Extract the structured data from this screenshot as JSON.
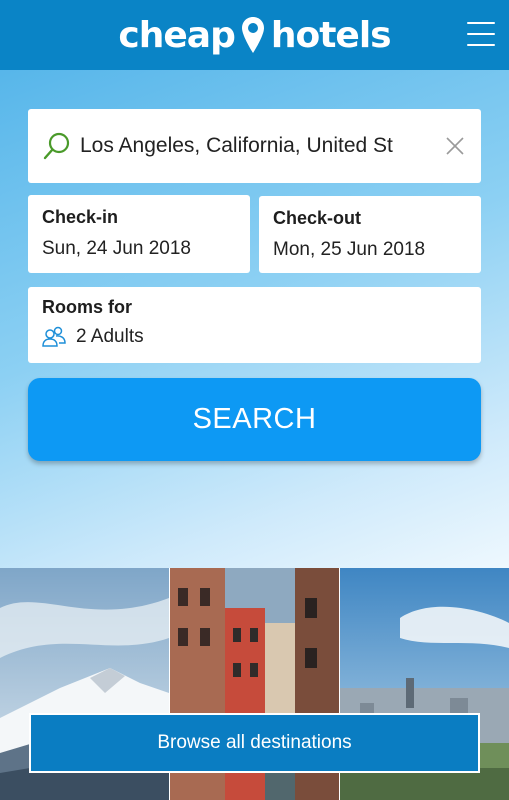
{
  "header": {
    "logo_left": "cheap",
    "logo_right": "hotels",
    "menu_icon": "hamburger-menu-icon"
  },
  "search_form": {
    "destination": {
      "value": "Los Angeles, California, United St",
      "icon": "search-icon",
      "clear_icon": "close-icon"
    },
    "check_in": {
      "label": "Check-in",
      "value": "Sun, 24 Jun 2018"
    },
    "check_out": {
      "label": "Check-out",
      "value": "Mon, 25 Jun 2018"
    },
    "rooms": {
      "label": "Rooms for",
      "value": "2 Adults",
      "icon": "people-icon"
    },
    "search_button": "SEARCH"
  },
  "gallery": {
    "images": [
      "mountain-photo",
      "canal-street-photo",
      "city-skyline-photo"
    ],
    "browse_button": "Browse all destinations"
  },
  "colors": {
    "header_bg": "#0a84c6",
    "search_button_bg": "#0d99f4",
    "browse_button_bg": "#0a7dc2",
    "search_icon": "#4a9a2a"
  }
}
